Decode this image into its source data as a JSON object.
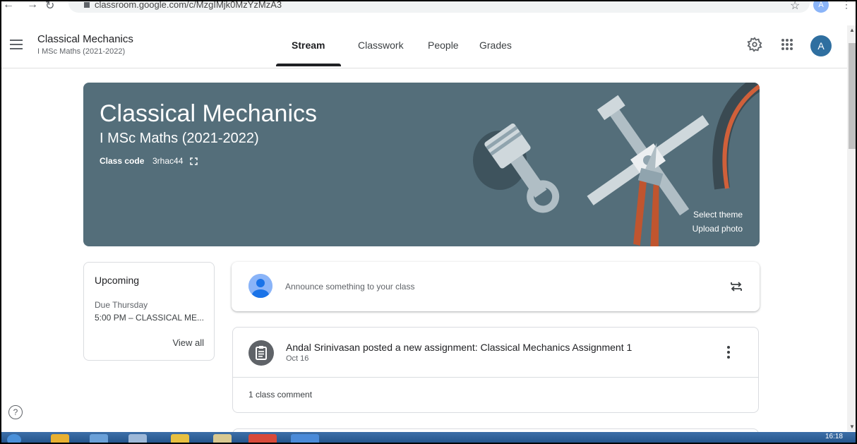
{
  "browser": {
    "url": "classroom.google.com/c/MzgIMjk0MzYzMzA3",
    "profile_initial": "A"
  },
  "header": {
    "class_title": "Classical Mechanics",
    "class_subtitle": "I MSc Maths (2021-2022)",
    "tabs": [
      {
        "label": "Stream",
        "active": true
      },
      {
        "label": "Classwork",
        "active": false
      },
      {
        "label": "People",
        "active": false
      },
      {
        "label": "Grades",
        "active": false
      }
    ],
    "avatar_initial": "A"
  },
  "banner": {
    "title": "Classical Mechanics",
    "subtitle": "I MSc Maths (2021-2022)",
    "class_code_label": "Class code",
    "class_code": "3rhac44",
    "select_theme": "Select theme",
    "upload_photo": "Upload photo",
    "color": "#546e7a"
  },
  "upcoming": {
    "title": "Upcoming",
    "due_label": "Due Thursday",
    "due_item": "5:00 PM – CLASSICAL ME...",
    "view_all": "View all"
  },
  "announce": {
    "placeholder": "Announce something to your class"
  },
  "post": {
    "title": "Andal Srinivasan posted a new assignment: Classical Mechanics Assignment 1",
    "date": "Oct 16",
    "comments": "1 class comment"
  },
  "taskbar": {
    "clock": "16:18"
  },
  "icons": [
    "hamburger-icon",
    "gear-icon",
    "apps-grid-icon",
    "expand-icon",
    "repost-icon",
    "assignment-icon",
    "more-vert-icon",
    "help-icon"
  ]
}
